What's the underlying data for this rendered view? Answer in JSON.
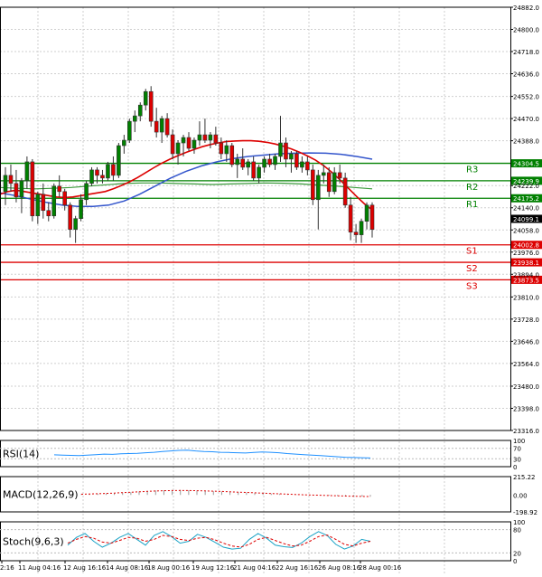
{
  "chart_data": {
    "type": "candlestick",
    "price_axis": {
      "ticks": [
        "24882.0",
        "24800.0",
        "24718.0",
        "24636.0",
        "24552.0",
        "24470.0",
        "24388.0",
        "24222.0",
        "24140.0",
        "24058.0",
        "23976.0",
        "23894.0",
        "23810.0",
        "23728.0",
        "23646.0",
        "23564.0",
        "23480.0",
        "23398.0",
        "23316.0"
      ],
      "ylim": [
        23316,
        24882
      ],
      "current_price": "24099.1"
    },
    "time_axis": {
      "labels": [
        "2:16",
        "11 Aug 04:16",
        "12 Aug 16:16",
        "14 Aug 08:16",
        "18 Aug 00:16",
        "19 Aug 12:16",
        "21 Aug 04:16",
        "22 Aug 16:16",
        "26 Aug 08:16",
        "28 Aug 00:16"
      ]
    },
    "levels": [
      {
        "name": "R3",
        "value": 24304.5,
        "label": "24304.5",
        "color": "#008000"
      },
      {
        "name": "R2",
        "value": 24239.9,
        "label": "24239.9",
        "color": "#008000"
      },
      {
        "name": "R1",
        "value": 24175.2,
        "label": "24175.2",
        "color": "#008000"
      },
      {
        "name": "S1",
        "value": 24002.8,
        "label": "24002.8",
        "color": "#dd0000"
      },
      {
        "name": "S2",
        "value": 23938.1,
        "label": "23938.1",
        "color": "#dd0000"
      },
      {
        "name": "S3",
        "value": 23873.5,
        "label": "23873.5",
        "color": "#dd0000"
      }
    ],
    "candles": [
      [
        24200,
        24290,
        24150,
        24260
      ],
      [
        24260,
        24300,
        24200,
        24230
      ],
      [
        24230,
        24280,
        24160,
        24180
      ],
      [
        24180,
        24250,
        24120,
        24240
      ],
      [
        24240,
        24330,
        24210,
        24310
      ],
      [
        24310,
        24320,
        24090,
        24110
      ],
      [
        24110,
        24200,
        24080,
        24190
      ],
      [
        24190,
        24230,
        24100,
        24130
      ],
      [
        24130,
        24160,
        24090,
        24110
      ],
      [
        24110,
        24230,
        24100,
        24220
      ],
      [
        24220,
        24260,
        24180,
        24200
      ],
      [
        24200,
        24210,
        24130,
        24150
      ],
      [
        24150,
        24160,
        24030,
        24060
      ],
      [
        24060,
        24110,
        24010,
        24100
      ],
      [
        24100,
        24190,
        24090,
        24170
      ],
      [
        24170,
        24240,
        24150,
        24230
      ],
      [
        24230,
        24290,
        24220,
        24280
      ],
      [
        24280,
        24290,
        24230,
        24260
      ],
      [
        24260,
        24280,
        24230,
        24250
      ],
      [
        24250,
        24310,
        24240,
        24300
      ],
      [
        24300,
        24330,
        24240,
        24260
      ],
      [
        24260,
        24380,
        24250,
        24370
      ],
      [
        24370,
        24410,
        24340,
        24390
      ],
      [
        24390,
        24470,
        24380,
        24460
      ],
      [
        24460,
        24500,
        24420,
        24480
      ],
      [
        24480,
        24530,
        24460,
        24520
      ],
      [
        24520,
        24580,
        24500,
        24570
      ],
      [
        24570,
        24590,
        24440,
        24460
      ],
      [
        24460,
        24510,
        24400,
        24420
      ],
      [
        24420,
        24480,
        24380,
        24470
      ],
      [
        24470,
        24490,
        24400,
        24410
      ],
      [
        24410,
        24430,
        24320,
        24340
      ],
      [
        24340,
        24390,
        24300,
        24380
      ],
      [
        24380,
        24410,
        24330,
        24400
      ],
      [
        24400,
        24420,
        24350,
        24360
      ],
      [
        24360,
        24400,
        24340,
        24390
      ],
      [
        24390,
        24460,
        24370,
        24410
      ],
      [
        24410,
        24470,
        24380,
        24390
      ],
      [
        24390,
        24420,
        24360,
        24410
      ],
      [
        24410,
        24440,
        24370,
        24380
      ],
      [
        24380,
        24400,
        24320,
        24340
      ],
      [
        24340,
        24390,
        24310,
        24370
      ],
      [
        24370,
        24380,
        24290,
        24300
      ],
      [
        24300,
        24340,
        24250,
        24320
      ],
      [
        24320,
        24360,
        24280,
        24290
      ],
      [
        24290,
        24320,
        24260,
        24310
      ],
      [
        24310,
        24330,
        24240,
        24250
      ],
      [
        24250,
        24300,
        24230,
        24290
      ],
      [
        24290,
        24330,
        24270,
        24320
      ],
      [
        24320,
        24340,
        24290,
        24300
      ],
      [
        24300,
        24340,
        24280,
        24330
      ],
      [
        24330,
        24480,
        24310,
        24380
      ],
      [
        24380,
        24400,
        24290,
        24320
      ],
      [
        24320,
        24350,
        24270,
        24340
      ],
      [
        24340,
        24350,
        24280,
        24290
      ],
      [
        24290,
        24330,
        24270,
        24310
      ],
      [
        24310,
        24330,
        24260,
        24280
      ],
      [
        24280,
        24300,
        24150,
        24170
      ],
      [
        24170,
        24280,
        24060,
        24260
      ],
      [
        24260,
        24300,
        24230,
        24270
      ],
      [
        24270,
        24290,
        24180,
        24200
      ],
      [
        24200,
        24290,
        24190,
        24270
      ],
      [
        24270,
        24300,
        24230,
        24250
      ],
      [
        24250,
        24270,
        24140,
        24150
      ],
      [
        24150,
        24180,
        24020,
        24050
      ],
      [
        24050,
        24080,
        24010,
        24040
      ],
      [
        24040,
        24100,
        24010,
        24090
      ],
      [
        24090,
        24160,
        24060,
        24150
      ],
      [
        24150,
        24160,
        24030,
        24060
      ]
    ],
    "sma_red": [
      24190,
      24200,
      24205,
      24200,
      24195,
      24190,
      24185,
      24180,
      24178,
      24180,
      24185,
      24190,
      24195,
      24200,
      24210,
      24222,
      24236,
      24252,
      24270,
      24288,
      24305,
      24320,
      24333,
      24345,
      24356,
      24366,
      24374,
      24380,
      24385,
      24387,
      24388,
      24388,
      24386,
      24382,
      24376,
      24368,
      24358,
      24346,
      24332,
      24316,
      24296,
      24272,
      24244,
      24214,
      24184,
      24156,
      24132
    ],
    "sma_blue": [
      24195,
      24185,
      24172,
      24160,
      24150,
      24145,
      24145,
      24150,
      24165,
      24190,
      24220,
      24250,
      24275,
      24295,
      24310,
      24322,
      24330,
      24335,
      24340,
      24342,
      24343,
      24342,
      24338,
      24330,
      24320
    ],
    "sma_green": [
      24215,
      24212,
      24210,
      24212,
      24215,
      24220,
      24225,
      24230,
      24232,
      24232,
      24230,
      24228,
      24226,
      24228,
      24230,
      24232,
      24231,
      24228,
      24224,
      24220,
      24215,
      24210
    ],
    "rsi": {
      "label": "RSI(14)",
      "ticks": [
        "100",
        "70",
        "30",
        "0"
      ],
      "values": [
        45,
        44,
        43,
        42,
        44,
        46,
        48,
        47,
        49,
        50,
        51,
        53,
        55,
        58,
        60,
        62,
        63,
        60,
        58,
        57,
        55,
        54,
        53,
        52,
        54,
        56,
        55,
        53,
        50,
        48,
        46,
        44,
        42,
        40,
        38,
        36,
        35,
        34,
        33
      ]
    },
    "macd": {
      "label": "MACD(12,26,9)",
      "ticks": [
        "215.22",
        "0.00",
        "-198.92"
      ],
      "hist": [
        10,
        12,
        14,
        18,
        22,
        28,
        34,
        40,
        46,
        52,
        56,
        58,
        58,
        56,
        52,
        48,
        44,
        40,
        36,
        32,
        28,
        24,
        20,
        16,
        12,
        8,
        4,
        1,
        -2,
        -5,
        -8,
        -11,
        -14,
        -16,
        -18,
        -20
      ],
      "signal": [
        8,
        11,
        14,
        18,
        22,
        27,
        32,
        37,
        42,
        46,
        50,
        52,
        53,
        52,
        50,
        47,
        44,
        41,
        37,
        33,
        29,
        25,
        21,
        17,
        13,
        9,
        5,
        2,
        -1,
        -4,
        -7,
        -10,
        -13,
        -15,
        -17,
        -19
      ]
    },
    "stoch": {
      "label": "Stoch(9,6,3)",
      "ticks": [
        "100",
        "80",
        "20",
        "0"
      ],
      "k": [
        40,
        60,
        70,
        50,
        35,
        45,
        60,
        70,
        55,
        40,
        65,
        75,
        62,
        45,
        50,
        68,
        60,
        48,
        35,
        30,
        32,
        55,
        70,
        58,
        40,
        36,
        34,
        45,
        62,
        75,
        65,
        42,
        30,
        38,
        55,
        50
      ],
      "d": [
        45,
        55,
        62,
        58,
        48,
        45,
        52,
        60,
        58,
        50,
        55,
        65,
        62,
        55,
        52,
        58,
        60,
        54,
        45,
        38,
        35,
        42,
        55,
        60,
        52,
        44,
        38,
        40,
        50,
        62,
        66,
        55,
        42,
        38,
        45,
        50
      ]
    }
  }
}
